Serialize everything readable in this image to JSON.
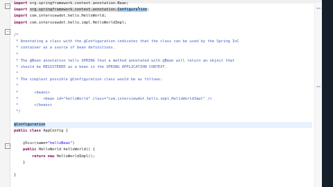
{
  "editor": {
    "lines": [
      "import org.springframework.context.annotation.Bean;",
      "import org.springframework.context.annotation.Configuration;",
      "import com.interviewdot.hello.HelloWorld;",
      "import com.interviewdot.hello.impl.HelloWorldImpl;",
      "",
      "/*",
      " * Annotating a class with the @Configuration indicates that the class can be used by the Spring IoC",
      " * container as a source of bean definitions.",
      " *",
      " * The @Bean annotation tells SPRING that a method annotated with @Bean will return an object that",
      " * should be REGISTERED as a bean in the SPRING APPLICATION CONTEXT.",
      " *",
      " * The simplest possible @Configuration class would be as follows:",
      " *",
      " *       <beans>",
      " *           <bean id=\"helloWorld\" class=\"com.interviewdot.hello.impl.HelloWorldImpl\" />",
      " *       </beans>",
      " */",
      "",
      "@Configuration",
      "public class AppConfig {",
      "",
      "    @Bean(name=\"helloBean\")",
      "    public HelloWorld helloWorld() {",
      "        return new HelloWorldImpl();",
      "    }",
      "",
      "}"
    ]
  }
}
